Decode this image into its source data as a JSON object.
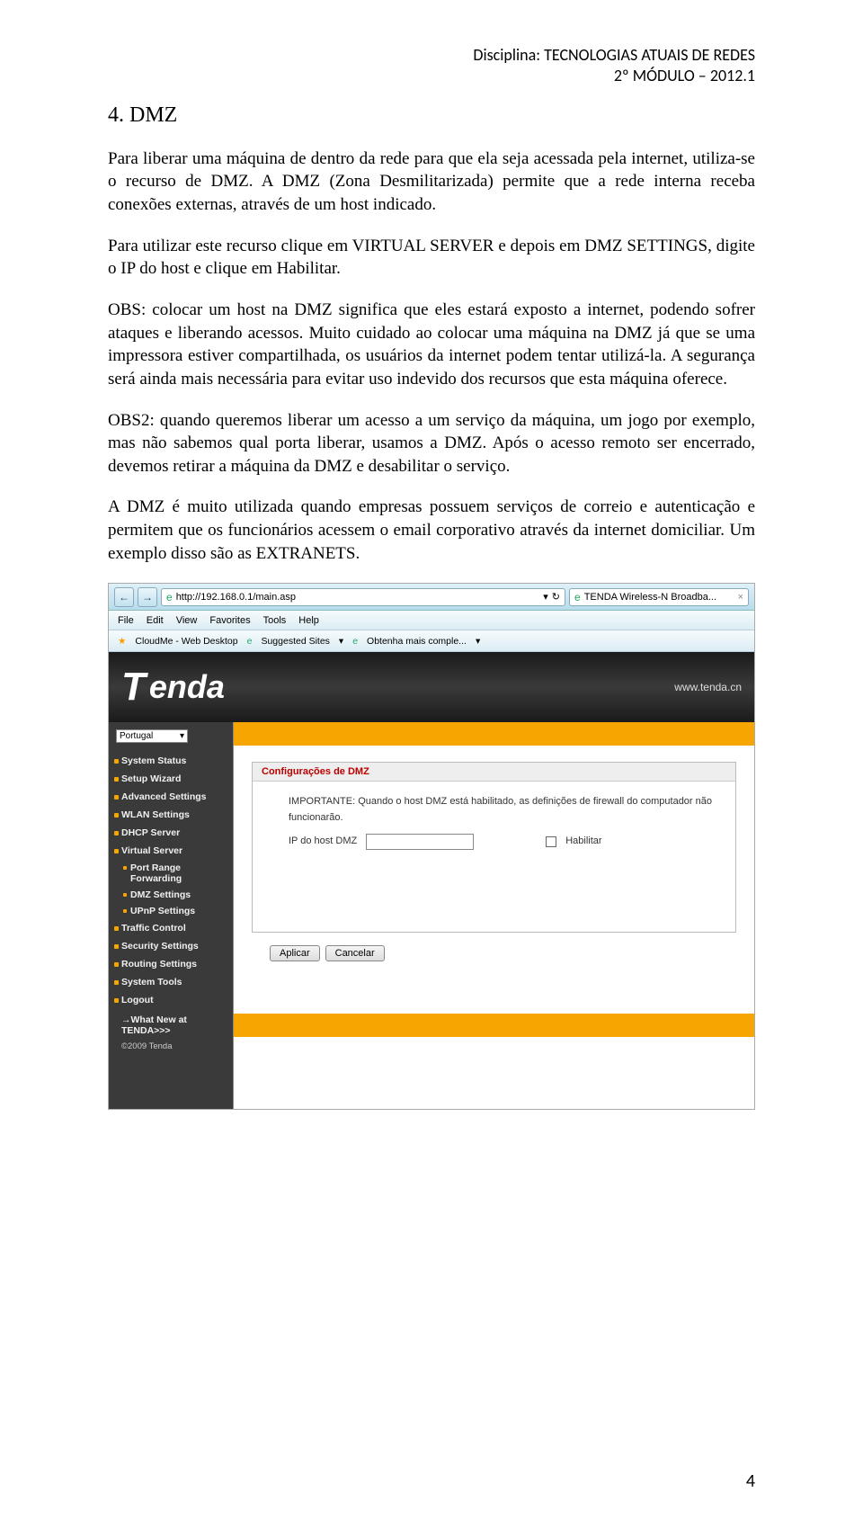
{
  "header": {
    "line1": "Disciplina: TECNOLOGIAS ATUAIS DE REDES",
    "line2": "2º MÓDULO – 2012.1"
  },
  "section_title": "4. DMZ",
  "paragraphs": {
    "p1": "Para liberar uma máquina de dentro da rede para que ela seja acessada pela internet, utiliza-se o recurso de DMZ. A DMZ (Zona Desmilitarizada) permite que a rede interna receba conexões externas, através de um host indicado.",
    "p2": "Para utilizar este recurso clique em VIRTUAL SERVER e depois em DMZ SETTINGS, digite o IP do host e clique em Habilitar.",
    "p3": "OBS: colocar um host na DMZ significa que eles estará exposto a internet, podendo sofrer ataques e liberando acessos. Muito cuidado ao colocar uma máquina na DMZ já que se uma impressora estiver compartilhada, os usuários da internet podem tentar utilizá-la. A segurança será ainda mais necessária para evitar uso indevido dos recursos que esta máquina oferece.",
    "p4": "OBS2: quando queremos liberar um acesso a um serviço da máquina, um jogo por exemplo, mas não sabemos qual porta liberar, usamos a DMZ. Após o acesso remoto ser encerrado, devemos retirar a máquina da DMZ e desabilitar o serviço.",
    "p5": "A DMZ é muito utilizada quando empresas possuem serviços de correio e autenticação e permitem que os funcionários acessem o email corporativo através da internet domiciliar. Um exemplo disso são as EXTRANETS."
  },
  "page_number": "4",
  "router": {
    "url": "http://192.168.0.1/main.asp",
    "tab_title": "TENDA Wireless-N Broadba...",
    "menus": [
      "File",
      "Edit",
      "View",
      "Favorites",
      "Tools",
      "Help"
    ],
    "favs": {
      "cloudme": "CloudMe - Web Desktop",
      "suggested": "Suggested Sites",
      "obtenha": "Obtenha mais comple..."
    },
    "brand": "Tenda",
    "brand_url": "www.tenda.cn",
    "language": "Portugal",
    "sidebar": {
      "items": [
        "System Status",
        "Setup Wizard",
        "Advanced Settings",
        "WLAN Settings",
        "DHCP Server",
        "Virtual Server"
      ],
      "subitems": [
        "Port Range Forwarding",
        "DMZ Settings",
        "UPnP Settings"
      ],
      "items2": [
        "Traffic Control",
        "Security Settings",
        "Routing Settings",
        "System Tools",
        "Logout"
      ],
      "whatnew": "→What New at TENDA>>>",
      "copyright": "©2009 Tenda"
    },
    "content": {
      "title": "Configurações de DMZ",
      "important": "IMPORTANTE: Quando o host DMZ está habilitado, as definições de firewall do computador não funcionarão.",
      "ip_label": "IP do host DMZ",
      "enable_label": "Habilitar",
      "apply": "Aplicar",
      "cancel": "Cancelar"
    }
  }
}
